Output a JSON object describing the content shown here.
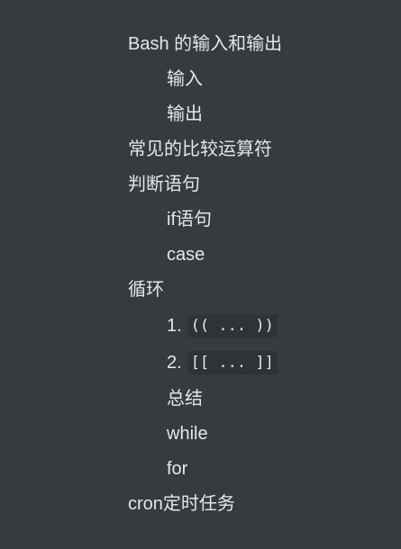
{
  "toc": {
    "items": [
      {
        "label": "Bash 的输入和输出"
      },
      {
        "label": "输入"
      },
      {
        "label": "输出"
      },
      {
        "label": "常见的比较运算符"
      },
      {
        "label": "判断语句"
      },
      {
        "label": "if语句"
      },
      {
        "label": "case"
      },
      {
        "label": "循环"
      },
      {
        "number": "1.",
        "code": "(( ... ))"
      },
      {
        "number": "2.",
        "code": "[[ ... ]]"
      },
      {
        "label": "总结"
      },
      {
        "label": "while"
      },
      {
        "label": "for"
      },
      {
        "label": "cron定时任务"
      }
    ]
  },
  "colors": {
    "background": "#363b40",
    "text": "#e6e6e6",
    "code_background": "#2f3337"
  }
}
